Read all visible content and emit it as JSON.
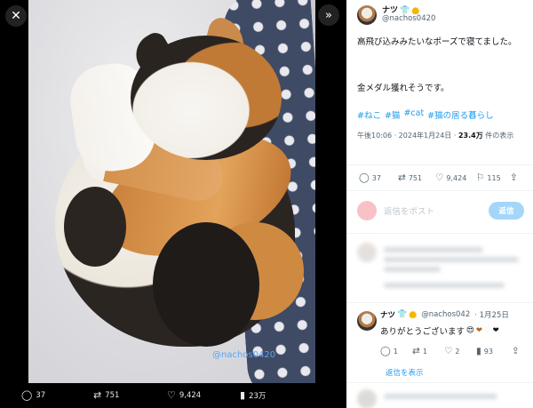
{
  "viewer": {
    "close_icon": "close-icon",
    "next_icon": "double-chevron-right-icon",
    "photo_watermark": "@nachos0420",
    "actions": {
      "reply_count": "37",
      "retweet_count": "751",
      "like_count": "9,424",
      "view_count": "23万"
    }
  },
  "post": {
    "author_name": "ナツ",
    "author_handle": "@nachos0420",
    "text_line1": "高飛び込みみたいなポーズで寝てました。",
    "text_line2": "金メダル獲れそうです。",
    "hashtags": [
      "#ねこ",
      "#猫",
      "#cat",
      "#猫の居る暮らし"
    ],
    "meta_time": "午後10:06 · 2024年1月24日 · ",
    "meta_views": "23.4万",
    "meta_views_suffix": " 件の表示",
    "actions": {
      "reply_count": "37",
      "retweet_count": "751",
      "like_count": "9,424",
      "bookmark_count": "115"
    }
  },
  "reply_box": {
    "placeholder": "返信をポスト",
    "button_label": "返信"
  },
  "reply": {
    "author_name": "ナツ",
    "author_handle": "@nachos042",
    "date": "· 1月25日",
    "text": "ありがとうございます",
    "actions": {
      "reply_count": "1",
      "retweet_count": "1",
      "like_count": "2",
      "view_count": "93"
    },
    "show_replies": "返信を表示"
  },
  "colors": {
    "accent": "#1d9bf0",
    "verified_badge": "#f4b400",
    "viewer_bg": "#000000"
  }
}
